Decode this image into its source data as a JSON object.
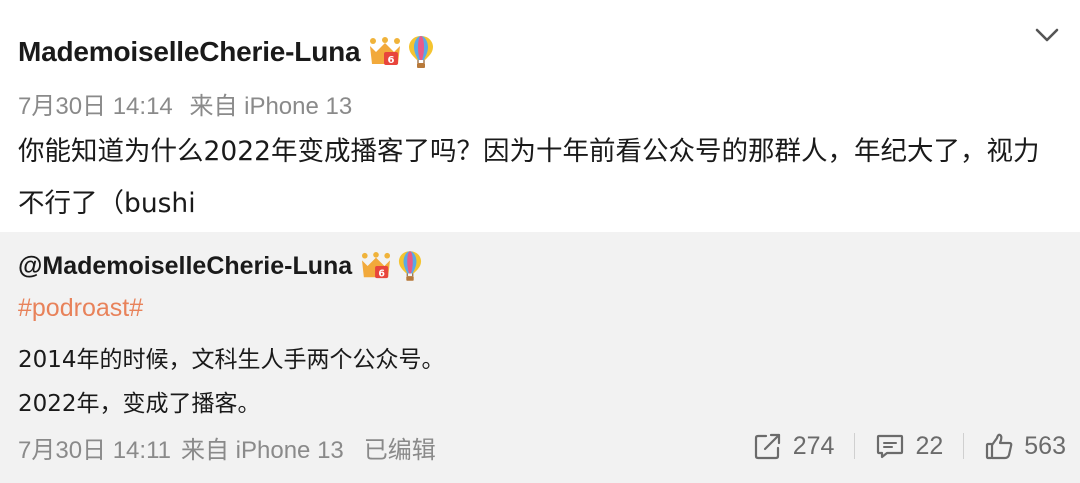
{
  "post": {
    "username": "MademoiselleCherie-Luna",
    "badges": [
      "crown-badge-icon",
      "hot-air-balloon-icon"
    ],
    "date": "7月30日 14:14",
    "source": "来自 iPhone 13",
    "content": "你能知道为什么2022年变成播客了吗？因为十年前看公众号的那群人，年纪大了，视力不行了（bushi",
    "menu_icon": "chevron-down-icon"
  },
  "repost": {
    "username": "@MademoiselleCherie-Luna",
    "topic": "#podroast#",
    "lines": [
      "2014年的时候，文科生人手两个公众号。",
      "2022年，变成了播客。"
    ],
    "date": "7月30日 14:11",
    "source": "来自 iPhone 13",
    "edited": "已编辑",
    "actions": {
      "share_count": "274",
      "comment_count": "22",
      "like_count": "563"
    }
  },
  "colors": {
    "topic": "#e8825a",
    "meta": "#8a8a8a",
    "repost_background": "#f2f2f2"
  }
}
